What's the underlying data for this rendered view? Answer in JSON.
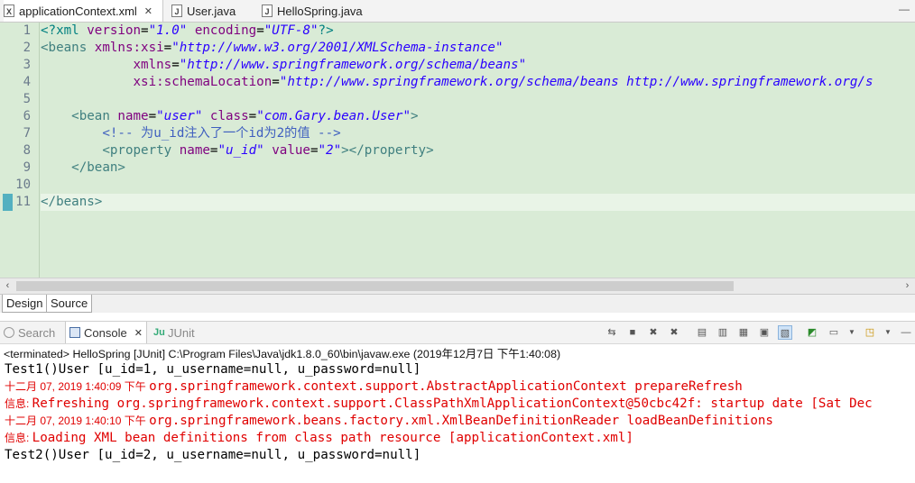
{
  "editor_tabs": [
    {
      "label": "applicationContext.xml",
      "icon": "xml-file-icon",
      "active": true
    },
    {
      "label": "User.java",
      "icon": "java-file-icon",
      "active": false
    },
    {
      "label": "HelloSpring.java",
      "icon": "java-file-icon",
      "active": false
    }
  ],
  "editor": {
    "line_numbers": [
      "1",
      "2",
      "3",
      "4",
      "5",
      "6",
      "7",
      "8",
      "9",
      "10",
      "11"
    ],
    "line1": {
      "a": "<?xml ",
      "b": "version",
      "c": "=",
      "d": "\"1.0\"",
      "e": " encoding",
      "f": "=",
      "g": "\"UTF-8\"",
      "h": "?>"
    },
    "line2": {
      "a": "<beans ",
      "b": "xmlns:xsi",
      "c": "=",
      "d": "\"http://www.w3.org/2001/XMLSchema-instance\""
    },
    "line3": {
      "a": "            ",
      "b": "xmlns",
      "c": "=",
      "d": "\"http://www.springframework.org/schema/beans\""
    },
    "line4": {
      "a": "            ",
      "b": "xsi:schemaLocation",
      "c": "=",
      "d": "\"http://www.springframework.org/schema/beans http://www.springframework.org/s"
    },
    "line6": {
      "a": "    <bean ",
      "b": "name",
      "c": "=",
      "d": "\"user\"",
      "e": " class",
      "f": "=",
      "g": "\"com.Gary.bean.User\"",
      "h": ">"
    },
    "line7": {
      "a": "        <!-- 为u_id注入了一个id为2的值 -->"
    },
    "line8": {
      "a": "        <property ",
      "b": "name",
      "c": "=",
      "d": "\"u_id\"",
      "e": " value",
      "f": "=",
      "g": "\"2\"",
      "h": "></property>"
    },
    "line9": {
      "a": "    </bean>"
    },
    "line11": {
      "a": "</beans>"
    }
  },
  "bottom_tabs": {
    "design": "Design",
    "source": "Source"
  },
  "views": [
    {
      "label": "Search",
      "icon": "search-icon"
    },
    {
      "label": "Console",
      "icon": "console-icon",
      "active": true
    },
    {
      "label": "JUnit",
      "icon": "junit-icon"
    }
  ],
  "toolbar_icons": [
    "pin-icon",
    "stop-icon",
    "remove-launch-icon",
    "remove-all-icon",
    "clear-console-icon",
    "scroll-lock-icon",
    "word-wrap-icon",
    "show-on-output-icon",
    "open-console-icon",
    "display-console-icon",
    "display-dropdown-icon",
    "new-console-icon",
    "new-console-dropdown-icon",
    "minimize-icon",
    "maximize-icon"
  ],
  "console": {
    "status": "<terminated> HelloSpring [JUnit] C:\\Program Files\\Java\\jdk1.8.0_60\\bin\\javaw.exe (2019年12月7日 下午1:40:08)",
    "lines": [
      {
        "prefix": "",
        "text": "Test1()User [u_id=1, u_username=null, u_password=null]"
      },
      {
        "prefix": "十二月 07, 2019 1:40:09 下午 ",
        "text": "org.springframework.context.support.AbstractApplicationContext prepareRefresh"
      },
      {
        "prefix": "信息: ",
        "text": "Refreshing org.springframework.context.support.ClassPathXmlApplicationContext@50cbc42f: startup date [Sat Dec"
      },
      {
        "prefix": "十二月 07, 2019 1:40:10 下午 ",
        "text": "org.springframework.beans.factory.xml.XmlBeanDefinitionReader loadBeanDefinitions"
      },
      {
        "prefix": "信息: ",
        "text": "Loading XML bean definitions from class path resource [applicationContext.xml]"
      },
      {
        "prefix": "",
        "text": "Test2()User [u_id=2, u_username=null, u_password=null]"
      }
    ]
  },
  "colors": {
    "editor_bg": "#d9ebd6",
    "error_text": "#e00000"
  }
}
